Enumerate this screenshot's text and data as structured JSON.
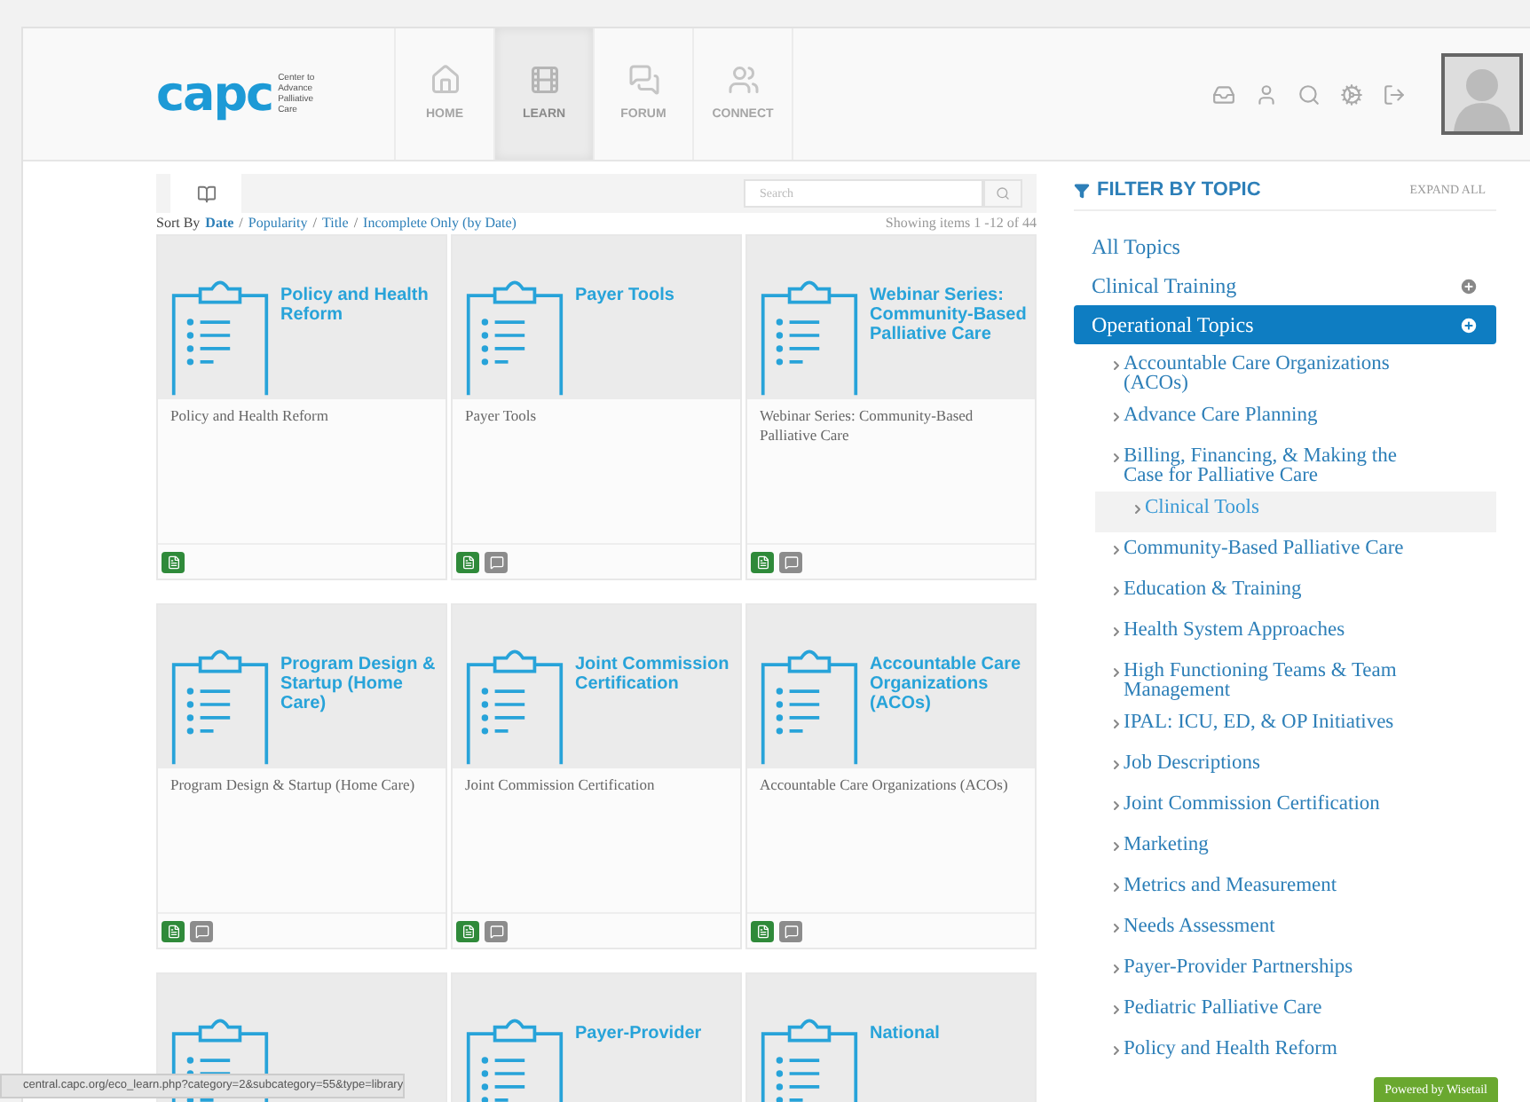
{
  "header": {
    "logo": {
      "mark": "capc",
      "tagline": "Center to Advance Palliative Care"
    },
    "nav": [
      {
        "label": "HOME",
        "selected": false
      },
      {
        "label": "LEARN",
        "selected": true
      },
      {
        "label": "FORUM",
        "selected": false
      },
      {
        "label": "CONNECT",
        "selected": false
      }
    ],
    "tools": [
      {
        "kind": "inbox"
      },
      {
        "kind": "user"
      },
      {
        "kind": "search"
      },
      {
        "kind": "gears"
      },
      {
        "kind": "signout"
      }
    ]
  },
  "toolbar": {
    "search": {
      "placeholder": "Search"
    }
  },
  "sort": {
    "label": "Sort By",
    "options": [
      {
        "label": "Date",
        "selected": true
      },
      {
        "label": "Popularity",
        "selected": false
      },
      {
        "label": "Title",
        "selected": false
      },
      {
        "label": "Incomplete Only (by Date)",
        "selected": false
      }
    ],
    "separator": "/",
    "count": "Showing items 1 -12 of 44"
  },
  "cards": [
    {
      "kind": "clipboard",
      "heading": "Policy and Health Reform",
      "caption": "Policy and Health Reform",
      "badges": [
        {
          "kind": "document"
        }
      ]
    },
    {
      "kind": "clipboard",
      "heading": "Payer Tools",
      "caption": "Payer Tools",
      "badges": [
        {
          "kind": "document"
        },
        {
          "kind": "chat"
        }
      ]
    },
    {
      "kind": "clipboard",
      "heading": "Webinar Series: Community-Based Palliative Care",
      "caption": "Webinar Series: Community-Based Palliative Care",
      "badges": [
        {
          "kind": "document"
        },
        {
          "kind": "chat"
        }
      ]
    },
    {
      "kind": "clipboard",
      "heading": "Program Design & Startup (Home Care)",
      "caption": "Program Design & Startup (Home Care)",
      "badges": [
        {
          "kind": "document"
        },
        {
          "kind": "chat"
        }
      ]
    },
    {
      "kind": "clipboard",
      "heading": "Joint Commission Certification",
      "caption": "Joint Commission Certification",
      "badges": [
        {
          "kind": "document"
        },
        {
          "kind": "chat"
        }
      ]
    },
    {
      "kind": "clipboard",
      "heading": "Accountable Care Organizations (ACOs)",
      "caption": "Accountable Care Organizations (ACOs)",
      "badges": [
        {
          "kind": "document"
        },
        {
          "kind": "chat"
        }
      ]
    },
    {
      "kind": "clipboard"
    },
    {
      "kind": "clipboard",
      "heading": "Payer-Provider"
    },
    {
      "kind": "clipboard",
      "heading": "National"
    }
  ],
  "filter": {
    "title": "FILTER BY TOPIC",
    "expand_all": "EXPAND ALL",
    "topics": [
      {
        "label": "All Topics",
        "selected": false,
        "expandable": false
      },
      {
        "label": "Clinical Training",
        "selected": false,
        "expandable": true
      },
      {
        "label": "Operational Topics",
        "selected": true,
        "expandable": true,
        "children": [
          {
            "label": "Accountable Care Organizations (ACOs)",
            "highlighted": false
          },
          {
            "label": "Advance Care Planning",
            "highlighted": false
          },
          {
            "label": "Billing, Financing, & Making the Case for Palliative Care",
            "highlighted": false
          },
          {
            "label": "Clinical Tools",
            "highlighted": true
          },
          {
            "label": "Community-Based Palliative Care",
            "highlighted": false
          },
          {
            "label": "Education & Training",
            "highlighted": false
          },
          {
            "label": "Health System Approaches",
            "highlighted": false
          },
          {
            "label": "High Functioning Teams & Team Management",
            "highlighted": false
          },
          {
            "label": "IPAL: ICU, ED, & OP Initiatives",
            "highlighted": false
          },
          {
            "label": "Job Descriptions",
            "highlighted": false
          },
          {
            "label": "Joint Commission Certification",
            "highlighted": false
          },
          {
            "label": "Marketing",
            "highlighted": false
          },
          {
            "label": "Metrics and Measurement",
            "highlighted": false
          },
          {
            "label": "Needs Assessment",
            "highlighted": false
          },
          {
            "label": "Payer-Provider Partnerships",
            "highlighted": false
          },
          {
            "label": "Pediatric Palliative Care",
            "highlighted": false
          },
          {
            "label": "Policy and Health Reform",
            "highlighted": false
          }
        ]
      }
    ]
  },
  "status_url": "central.capc.org/eco_learn.php?category=2&subcategory=55&type=library",
  "powered_by": "Powered by Wisetail"
}
